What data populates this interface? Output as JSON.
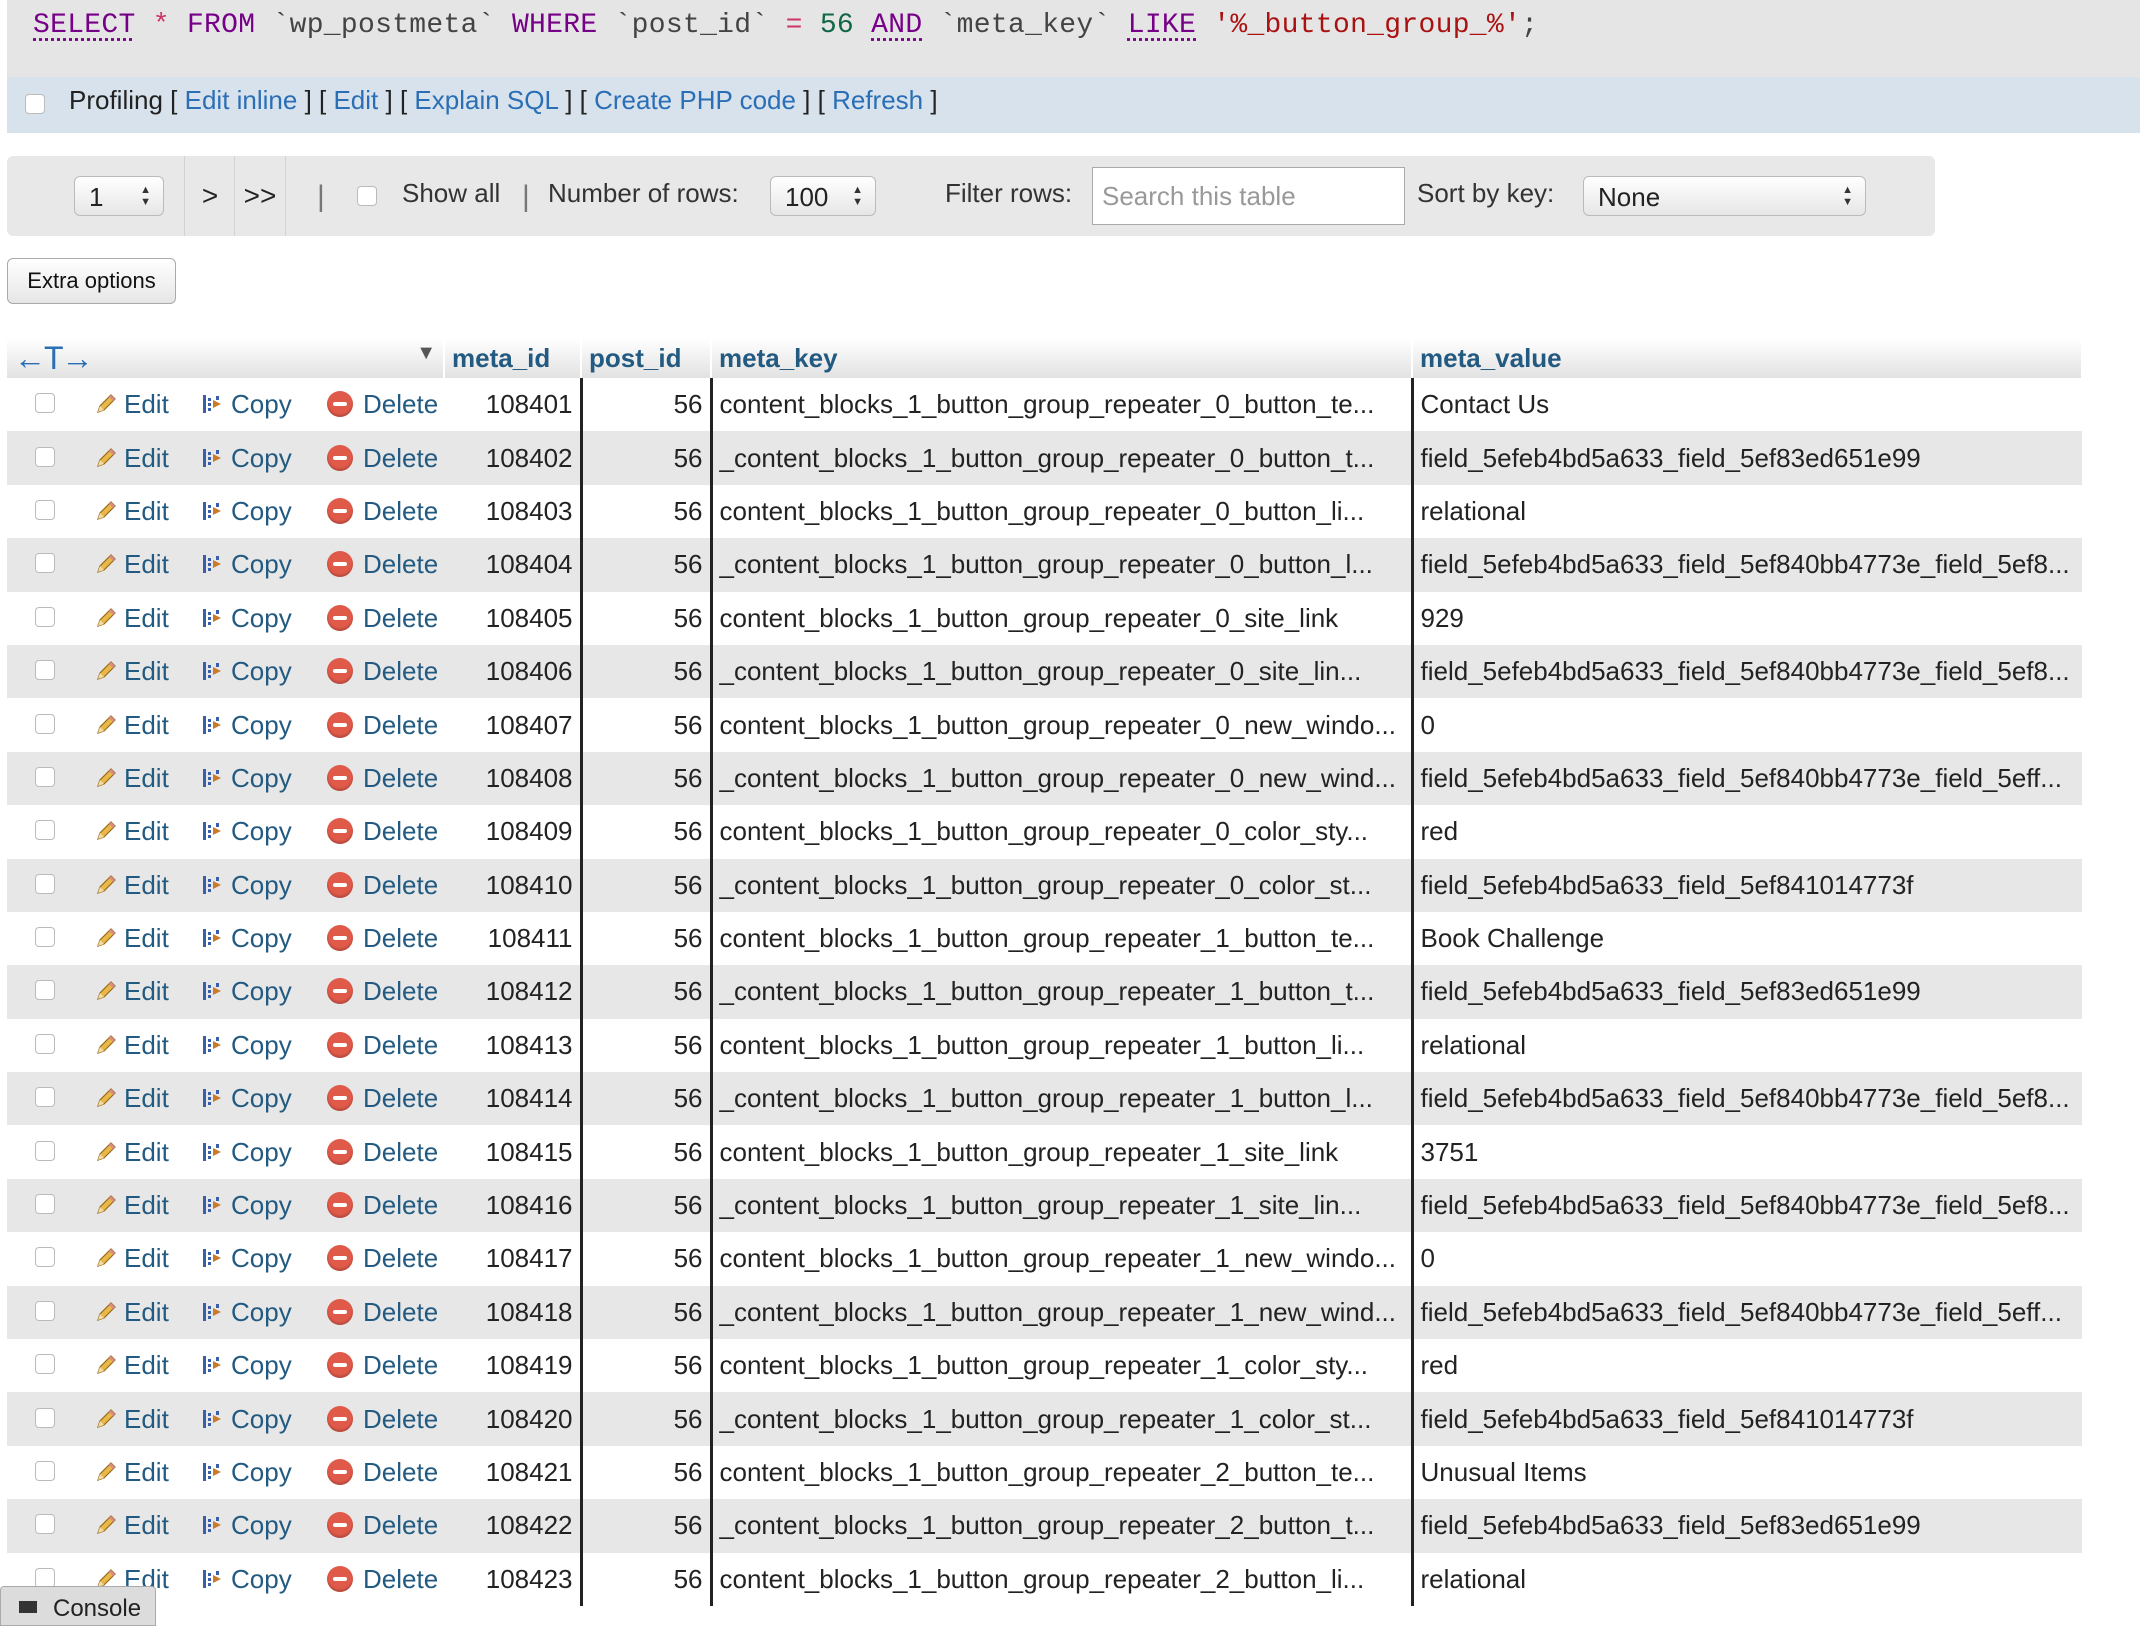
{
  "sql": {
    "select": "SELECT",
    "star": "*",
    "from": "FROM",
    "table": "`wp_postmeta`",
    "where": "WHERE",
    "col1": "`post_id`",
    "eq": "=",
    "val1": "56",
    "and": "AND",
    "col2": "`meta_key`",
    "like": "LIKE",
    "pattern": "'%_button_group_%'",
    "end": ";"
  },
  "toolbar": {
    "profiling": "Profiling",
    "edit_inline": "Edit inline",
    "edit": "Edit",
    "explain_sql": "Explain SQL",
    "create_php": "Create PHP code",
    "refresh": "Refresh"
  },
  "nav": {
    "page": "1",
    "next": ">",
    "last": ">>",
    "show_all": "Show all",
    "rows_label": "Number of rows:",
    "rows_value": "100",
    "filter_label": "Filter rows:",
    "filter_placeholder": "Search this table",
    "sort_label": "Sort by key:",
    "sort_value": "None"
  },
  "extra_options": "Extra options",
  "table": {
    "col_arrows": "←T→",
    "headers": [
      "meta_id",
      "post_id",
      "meta_key",
      "meta_value"
    ],
    "action_labels": {
      "edit": "Edit",
      "copy": "Copy",
      "delete": "Delete"
    },
    "rows": [
      [
        "108401",
        "56",
        "content_blocks_1_button_group_repeater_0_button_te...",
        "Contact Us"
      ],
      [
        "108402",
        "56",
        "_content_blocks_1_button_group_repeater_0_button_t...",
        "field_5efeb4bd5a633_field_5ef83ed651e99"
      ],
      [
        "108403",
        "56",
        "content_blocks_1_button_group_repeater_0_button_li...",
        "relational"
      ],
      [
        "108404",
        "56",
        "_content_blocks_1_button_group_repeater_0_button_l...",
        "field_5efeb4bd5a633_field_5ef840bb4773e_field_5ef8..."
      ],
      [
        "108405",
        "56",
        "content_blocks_1_button_group_repeater_0_site_link",
        "929"
      ],
      [
        "108406",
        "56",
        "_content_blocks_1_button_group_repeater_0_site_lin...",
        "field_5efeb4bd5a633_field_5ef840bb4773e_field_5ef8..."
      ],
      [
        "108407",
        "56",
        "content_blocks_1_button_group_repeater_0_new_windo...",
        "0"
      ],
      [
        "108408",
        "56",
        "_content_blocks_1_button_group_repeater_0_new_wind...",
        "field_5efeb4bd5a633_field_5ef840bb4773e_field_5eff..."
      ],
      [
        "108409",
        "56",
        "content_blocks_1_button_group_repeater_0_color_sty...",
        "red"
      ],
      [
        "108410",
        "56",
        "_content_blocks_1_button_group_repeater_0_color_st...",
        "field_5efeb4bd5a633_field_5ef841014773f"
      ],
      [
        "108411",
        "56",
        "content_blocks_1_button_group_repeater_1_button_te...",
        "Book Challenge"
      ],
      [
        "108412",
        "56",
        "_content_blocks_1_button_group_repeater_1_button_t...",
        "field_5efeb4bd5a633_field_5ef83ed651e99"
      ],
      [
        "108413",
        "56",
        "content_blocks_1_button_group_repeater_1_button_li...",
        "relational"
      ],
      [
        "108414",
        "56",
        "_content_blocks_1_button_group_repeater_1_button_l...",
        "field_5efeb4bd5a633_field_5ef840bb4773e_field_5ef8..."
      ],
      [
        "108415",
        "56",
        "content_blocks_1_button_group_repeater_1_site_link",
        "3751"
      ],
      [
        "108416",
        "56",
        "_content_blocks_1_button_group_repeater_1_site_lin...",
        "field_5efeb4bd5a633_field_5ef840bb4773e_field_5ef8..."
      ],
      [
        "108417",
        "56",
        "content_blocks_1_button_group_repeater_1_new_windo...",
        "0"
      ],
      [
        "108418",
        "56",
        "_content_blocks_1_button_group_repeater_1_new_wind...",
        "field_5efeb4bd5a633_field_5ef840bb4773e_field_5eff..."
      ],
      [
        "108419",
        "56",
        "content_blocks_1_button_group_repeater_1_color_sty...",
        "red"
      ],
      [
        "108420",
        "56",
        "_content_blocks_1_button_group_repeater_1_color_st...",
        "field_5efeb4bd5a633_field_5ef841014773f"
      ],
      [
        "108421",
        "56",
        "content_blocks_1_button_group_repeater_2_button_te...",
        "Unusual Items"
      ],
      [
        "108422",
        "56",
        "_content_blocks_1_button_group_repeater_2_button_t...",
        "field_5efeb4bd5a633_field_5ef83ed651e99"
      ],
      [
        "108423",
        "56",
        "content_blocks_1_button_group_repeater_2_button_li...",
        "relational"
      ]
    ]
  },
  "console": "Console",
  "colors": {
    "link": "#235a81",
    "delete_icon": "#e05a4a",
    "sql_keyword": "#770088",
    "stripe": "#e7e7e7"
  }
}
